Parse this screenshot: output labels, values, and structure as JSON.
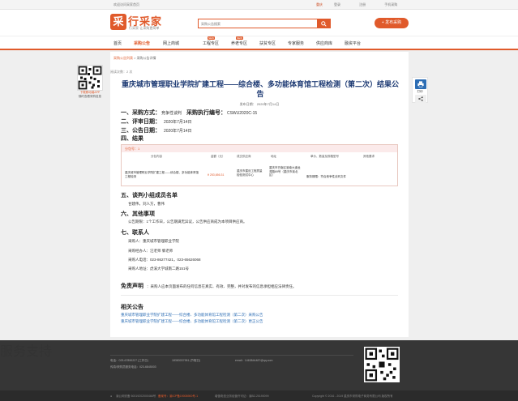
{
  "topbar": {
    "home": "欢迎访问采家首页",
    "location": "重庆",
    "links": [
      "登录",
      "注册",
      "手机采购"
    ]
  },
  "header": {
    "logo_mark": "采",
    "logo_text": "行采家",
    "logo_sub": "行采家·让采购更简单",
    "search_placeholder": "采购公告搜索",
    "search_icon": "search-icon",
    "publish_button": "+ 发布采购"
  },
  "nav": {
    "items": [
      {
        "label": "首页",
        "active": false
      },
      {
        "label": "采购公告",
        "active": true
      },
      {
        "label": "网上商城",
        "active": false
      },
      {
        "label": "工程专区",
        "active": false,
        "badge": "NEW"
      },
      {
        "label": "养老专区",
        "active": false,
        "badge": "NEW"
      },
      {
        "label": "扶贫专区",
        "active": false
      },
      {
        "label": "专家服务",
        "active": false
      },
      {
        "label": "供应商库",
        "active": false
      },
      {
        "label": "融资平台",
        "active": false
      }
    ]
  },
  "breadcrumb": {
    "root": "采购公告列表",
    "sep": " > ",
    "current": "采购公告详情"
  },
  "side": {
    "qr_label_1": "下载移动端APP",
    "qr_label_2": "随时查看采购信息"
  },
  "print": {
    "icon_label": "打印",
    "share_icon": "share-icon"
  },
  "article": {
    "read_count": "阅读次数：2 次",
    "title": "重庆城市管理职业学院扩建工程——综合楼、多功能体育馆工程检测（第二次）结果公告",
    "publish_time": "发布日期： 2020年7月14日",
    "sections": {
      "method_label": "一、采购方式：",
      "method_value": "竞争性谈判",
      "code_label": "采购执行编号：",
      "code_value": "CSWU2020C-15",
      "review_label": "二、评审日期：",
      "review_value": "2020年7月14日",
      "notice_label": "三、公告日期：",
      "notice_value": "2020年7月14日",
      "result_label": "四、结果",
      "panel_label": "五、谈判小组成员名单",
      "panel_value": "甘建伟，刘人方，曹伟",
      "other_label": "六、其他事项",
      "other_value": "公告期限：1个工作日，公告期满无异议，公告供应商成为本项目供应商。",
      "contact_label": "七、联系人"
    },
    "table": {
      "package": "分包号：1",
      "headers": [
        "分包内容",
        "金额（元）",
        "成交供应商",
        "地址",
        "单价、数量及规格型号",
        "其他要求"
      ],
      "row": {
        "content": "重庆城市管理职业学院扩建工程——综合楼、多功能体育馆工程检测",
        "amount": "¥ 253,656.31",
        "supplier": "重庆市建设工程质量检验测试中心",
        "address": "重庆市巴南区渝南大道龙湾路69号（重庆市渝北区）",
        "spec": "服务期限：符合竞争性谈判文件",
        "other": ""
      }
    },
    "contacts": [
      "采购人：重庆城市管理职业学院",
      "采购经办人：汪老师  黎老师",
      "采购人电话：023-86277421，023-65626068",
      "采购人地址：虎溪大学城南二路151号"
    ],
    "disclaimer_label": "免责声明",
    "disclaimer": "：采购人应本页面发布的任何信息在真实、有效、完整，并对发布的信息承担相应法律责任。",
    "related_label": "相关公告",
    "related": [
      "重庆城市管理职业学院扩建工程——综合楼、多功能体育馆工程检测（第二次）采购公告",
      "重庆城市管理职业学院扩建工程——综合楼、多功能体育馆工程检测（第二次）更正公告"
    ]
  },
  "footer": {
    "title": "服务支持",
    "phone": "电话：023-67890227 (工作日)",
    "phone2": "18383037951 (节假日)",
    "email": "email：1463844487@qq.com",
    "fax": "传真/采购员服务电话：023-6845003",
    "copyright": "Copyright © 2016 - 2019 重庆市采购电子商务有限公司 版权所有",
    "icp": "渝公网安备 50019202000466号",
    "license": "备案号：渝ICP备19008900号-1",
    "isp": "增值电信业务经营许可证：渝B2-20190099"
  },
  "colors": {
    "brand": "#e05a2b",
    "title_blue": "#1d3a73",
    "link_blue": "#2c6db4"
  }
}
